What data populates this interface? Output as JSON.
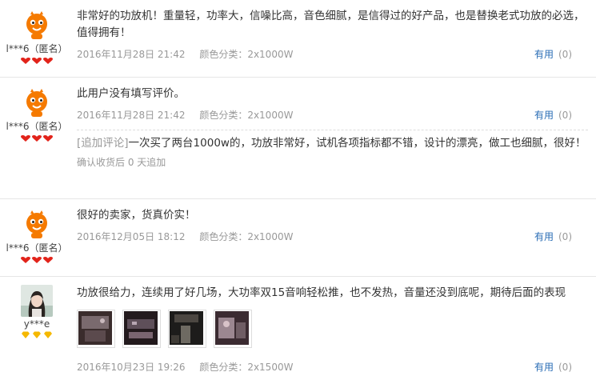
{
  "reviews": [
    {
      "user": "l***6（匿名）",
      "avatar": "taobao-mascot",
      "text": "非常好的功放机！重量轻，功率大，信噪比高，音色细腻，是信得过的好产品，也是替换老式功放的必选，值得拥有！",
      "date": "2016年11月28日 21:42",
      "sku": "颜色分类：2x1000W",
      "useful_label": "有用",
      "useful_count": "(0)"
    },
    {
      "user": "l***6（匿名）",
      "avatar": "taobao-mascot",
      "text": "此用户没有填写评价。",
      "date": "2016年11月28日 21:42",
      "sku": "颜色分类：2x1000W",
      "useful_label": "有用",
      "useful_count": "(0)",
      "append_tag": "[追加评论]",
      "append_text": "一次买了两台1000w的，功放非常好，试机各项指标都不错，设计的漂亮，做工也细腻，很好！",
      "append_note": "确认收货后 0 天追加"
    },
    {
      "user": "l***6（匿名）",
      "avatar": "taobao-mascot",
      "text": "很好的卖家，货真价实！",
      "date": "2016年12月05日 18:12",
      "sku": "颜色分类：2x1000W",
      "useful_label": "有用",
      "useful_count": "(0)"
    },
    {
      "user": "y***e",
      "avatar": "user-photo",
      "text": "功放很给力，连续用了好几场，大功率双15音响轻松推，也不发热，音量还没到底呢，期待后面的表现",
      "date": "2016年10月23日 19:26",
      "sku": "颜色分类：2x1500W",
      "useful_label": "有用",
      "useful_count": "(0)",
      "photos": [
        "photo-venue-1",
        "photo-venue-2",
        "photo-venue-3",
        "photo-venue-4"
      ]
    }
  ],
  "colors": {
    "link": "#2a6db5",
    "muted": "#999999",
    "heart": "#e2231a",
    "diamond": "#f5b800",
    "mascot": "#f57a00"
  }
}
